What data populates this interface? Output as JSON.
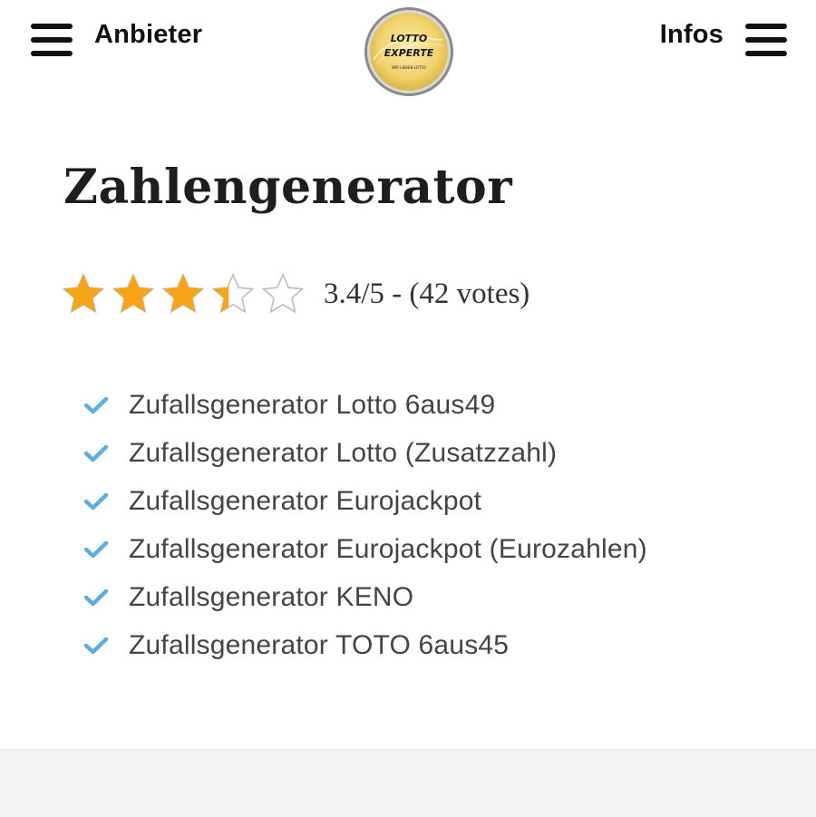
{
  "header": {
    "left_menu_label": "Anbieter",
    "right_menu_label": "Infos",
    "logo": {
      "line1": "LOTTO",
      "line2": "EXPERTE",
      "tagline": "WIR LIEBEN LOTTO",
      "colors": {
        "ring": "#c9a13a",
        "fill": "#f3d66a",
        "text": "#1a1a1a"
      }
    }
  },
  "main": {
    "title": "Zahlengenerator",
    "rating": {
      "value": 3.4,
      "max": 5,
      "text": "3.4/5 - (42 votes)",
      "star_color": "#f7a416",
      "empty_star_color": "#bdbdbd"
    },
    "features": [
      {
        "text": "Zufallsgenerator Lotto 6aus49"
      },
      {
        "text": "Zufallsgenerator Lotto (Zusatzzahl)"
      },
      {
        "text": "Zufallsgenerator Eurojackpot"
      },
      {
        "text": "Zufallsgenerator Eurojackpot (Eurozahlen)"
      },
      {
        "text": "Zufallsgenerator KENO"
      },
      {
        "text": "Zufallsgenerator TOTO 6aus45"
      }
    ],
    "check_color": "#5ab0db"
  }
}
